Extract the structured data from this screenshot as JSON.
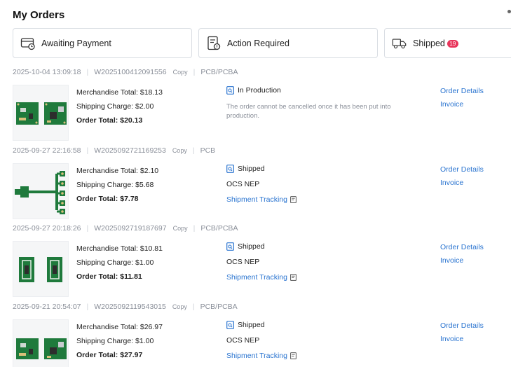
{
  "page": {
    "title": "My Orders"
  },
  "tabs": [
    {
      "label": "Awaiting Payment",
      "icon": "wallet-clock-icon"
    },
    {
      "label": "Action Required",
      "icon": "document-alert-icon"
    },
    {
      "label": "Shipped",
      "icon": "truck-icon",
      "badge": "19"
    }
  ],
  "orders": [
    {
      "date": "2025-10-04 13:09:18",
      "order_no": "W2025100412091556",
      "copy": "Copy",
      "type": "PCB/PCBA",
      "merchandise": "Merchandise Total: $18.13",
      "shipping": "Shipping Charge: $2.00",
      "total": "Order Total: $20.13",
      "status": "In Production",
      "note": "The order cannot be cancelled once it has been put into production.",
      "details": "Order Details",
      "invoice": "Invoice",
      "thumb": "pcba-boards-icon"
    },
    {
      "date": "2025-09-27 22:16:58",
      "order_no": "W2025092721169253",
      "copy": "Copy",
      "type": "PCB",
      "merchandise": "Merchandise Total: $2.10",
      "shipping": "Shipping Charge: $5.68",
      "total": "Order Total: $7.78",
      "status": "Shipped",
      "carrier": "OCS NEP",
      "tracking": "Shipment Tracking",
      "details": "Order Details",
      "invoice": "Invoice",
      "thumb": "flex-pcb-icon"
    },
    {
      "date": "2025-09-27 20:18:26",
      "order_no": "W2025092719187697",
      "copy": "Copy",
      "type": "PCB/PCBA",
      "merchandise": "Merchandise Total: $10.81",
      "shipping": "Shipping Charge: $1.00",
      "total": "Order Total: $11.81",
      "status": "Shipped",
      "carrier": "OCS NEP",
      "tracking": "Shipment Tracking",
      "details": "Order Details",
      "invoice": "Invoice",
      "thumb": "pcb-pair-icon"
    },
    {
      "date": "2025-09-21 20:54:07",
      "order_no": "W2025092119543015",
      "copy": "Copy",
      "type": "PCB/PCBA",
      "merchandise": "Merchandise Total: $26.97",
      "shipping": "Shipping Charge: $1.00",
      "total": "Order Total: $27.97",
      "status": "Shipped",
      "carrier": "OCS NEP",
      "tracking": "Shipment Tracking",
      "details": "Order Details",
      "invoice": "Invoice",
      "thumb": "pcba-boards-icon"
    }
  ],
  "colors": {
    "accent": "#2a74d0",
    "badge": "#e8345a",
    "pcb_green": "#1f7a3c",
    "muted": "#8a8f99"
  }
}
